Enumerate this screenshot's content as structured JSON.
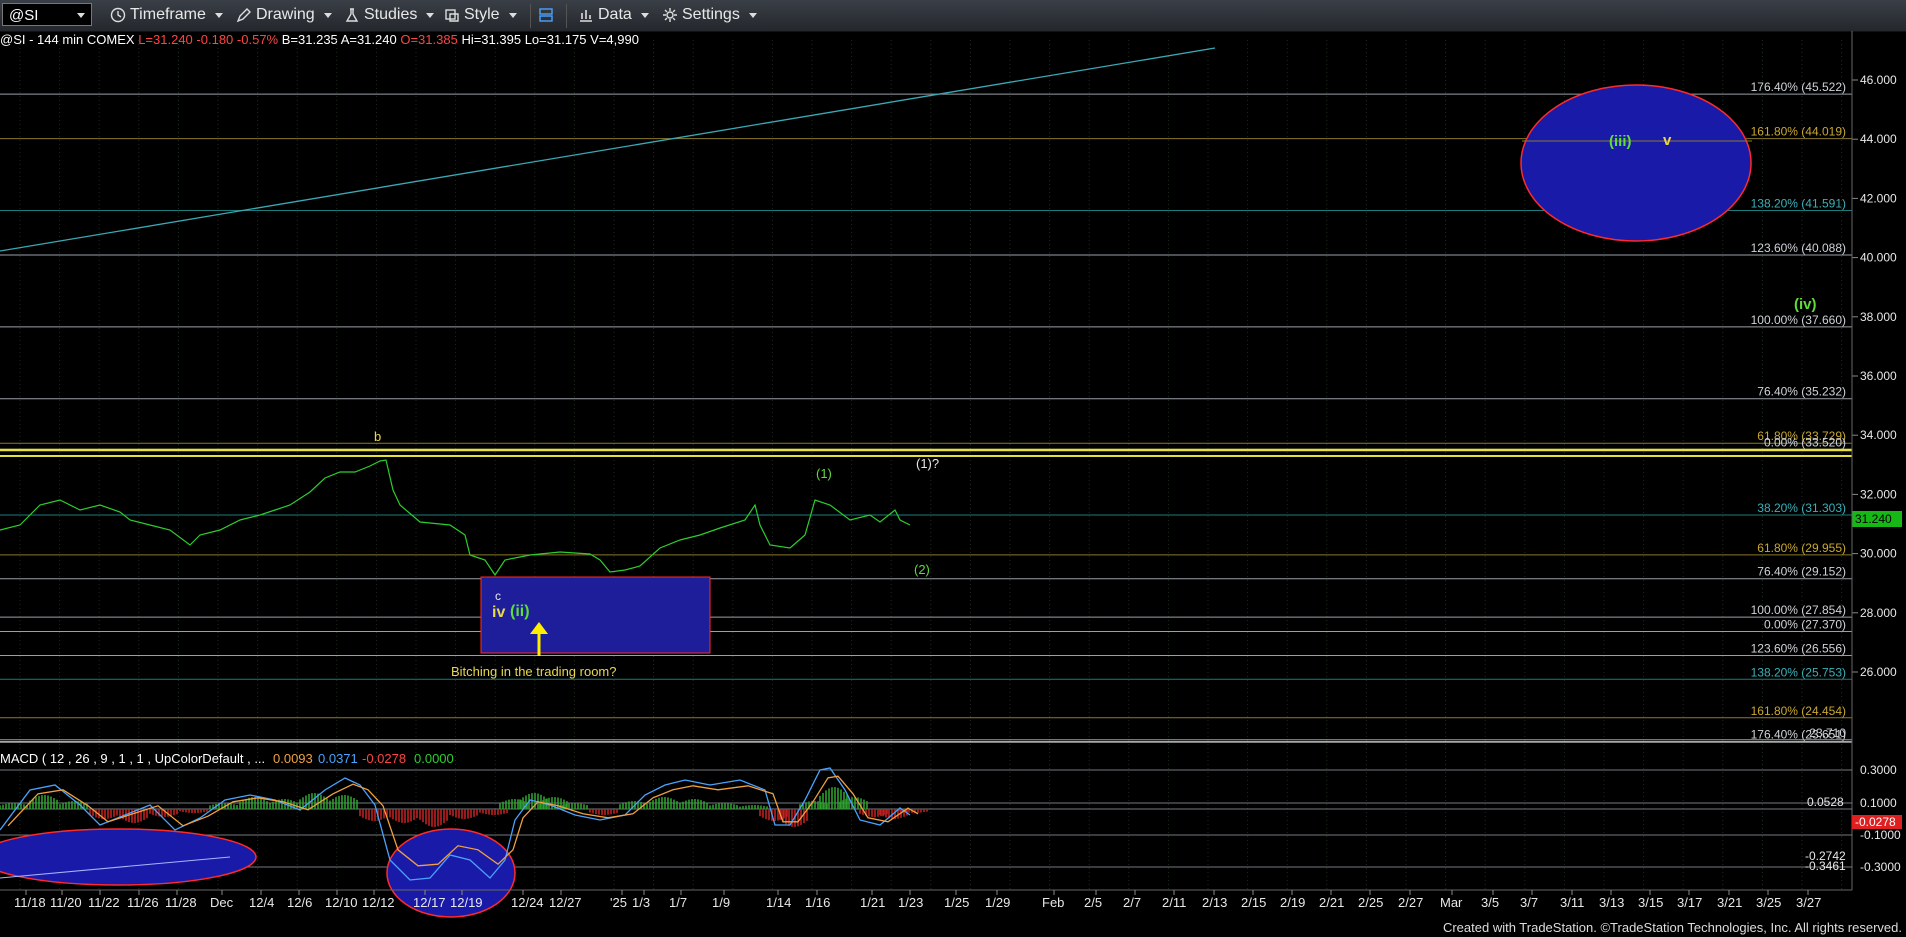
{
  "toolbar": {
    "symbol": "@SI",
    "timeframe": "Timeframe",
    "drawing": "Drawing",
    "studies": "Studies",
    "style": "Style",
    "data": "Data",
    "settings": "Settings"
  },
  "quote": {
    "title": "@SI - 144 min",
    "exchange": "COMEX",
    "last": "L=31.240",
    "change": "-0.180",
    "pct": "-0.57%",
    "bid": "B=31.235",
    "ask": "A=31.240",
    "open": "O=31.385",
    "high": "Hi=31.395",
    "low": "Lo=31.175",
    "volume": "V=4,990"
  },
  "price_axis": [
    "46.000",
    "44.000",
    "42.000",
    "40.000",
    "38.000",
    "36.000",
    "34.000",
    "32.000",
    "30.000",
    "28.000",
    "26.000"
  ],
  "last_price_tag": "31.240",
  "fib_levels": [
    {
      "label": "176.40% (45.522)",
      "price": 45.522,
      "color": "#9aa0a8"
    },
    {
      "label": "161.80% (44.019)",
      "price": 44.019,
      "color": "#8a7a2a"
    },
    {
      "label": "138.20% (41.591)",
      "price": 41.591,
      "color": "#1c7c7c"
    },
    {
      "label": "123.60% (40.088)",
      "price": 40.088,
      "color": "#9aa0a8"
    },
    {
      "label": "100.00% (37.660)",
      "price": 37.66,
      "color": "#9aa0a8"
    },
    {
      "label": "76.40% (35.232)",
      "price": 35.232,
      "color": "#9aa0a8"
    },
    {
      "label": "61.80% (33.729)",
      "price": 33.729,
      "color": "#8a7a2a"
    },
    {
      "label": "0.00% (33.520)",
      "price": 33.52,
      "color": "#9aa0a8"
    },
    {
      "label": "38.20% (31.303)",
      "price": 31.303,
      "color": "#1c7c7c"
    },
    {
      "label": "61.80% (29.955)",
      "price": 29.955,
      "color": "#8a7a2a"
    },
    {
      "label": "76.40% (29.152)",
      "price": 29.152,
      "color": "#9aa0a8"
    },
    {
      "label": "100.00% (27.854)",
      "price": 27.854,
      "color": "#9aa0a8"
    },
    {
      "label": "0.00% (27.370)",
      "price": 27.37,
      "color": "#9aa0a8"
    },
    {
      "label": "123.60% (26.556)",
      "price": 26.556,
      "color": "#9aa0a8"
    },
    {
      "label": "138.20% (25.753)",
      "price": 25.753,
      "color": "#1c7c7c"
    },
    {
      "label": "161.80% (24.454)",
      "price": 24.454,
      "color": "#8a7a2a"
    },
    {
      "label": "176.40% (23.651)",
      "price": 23.651,
      "color": "#9aa0a8"
    },
    {
      "label": "23.710",
      "price": 23.71,
      "color": "#9aa0a8"
    }
  ],
  "annotations": {
    "b": "b",
    "c": "c",
    "iv": "iv",
    "ii": "(ii)",
    "one": "(1)",
    "one_q": "(1)?",
    "two": "(2)",
    "iii": "(iii)",
    "v": "v",
    "iv_green": "(iv)",
    "comment": "Bitching in the trading room?"
  },
  "macd": {
    "legend": "MACD ( 12 , 26 , 9 , 1 , 1 , UpColorDefault , ...",
    "v1": "0.0093",
    "v2": "0.0371",
    "v3": "-0.0278",
    "v4": "0.0000",
    "axis": [
      "0.3000",
      "0.1000",
      "-0.1000",
      "-0.3000"
    ],
    "tag_a": "0.0528",
    "tag_b": "-0.0278",
    "tag_c": "-0.2742",
    "tag_d": "-0.3461"
  },
  "date_labels": [
    "11/18",
    "11/20",
    "11/22",
    "11/26",
    "11/28",
    "Dec",
    "12/4",
    "12/6",
    "12/10",
    "12/12",
    "12/17",
    "12/19",
    "12/24",
    "12/27",
    "'25",
    "1/3",
    "1/7",
    "1/9",
    "1/14",
    "1/16",
    "1/21",
    "1/23",
    "1/25",
    "1/29",
    "Feb",
    "2/5",
    "2/7",
    "2/11",
    "2/13",
    "2/15",
    "2/19",
    "2/21",
    "2/25",
    "2/27",
    "Mar",
    "3/5",
    "3/7",
    "3/11",
    "3/13",
    "3/15",
    "3/17",
    "3/21",
    "3/25",
    "3/27"
  ],
  "footer": "Created with TradeStation. ©TradeStation Technologies, Inc. All rights reserved.",
  "colors": {
    "price": "#2ecc2e",
    "fib_gray": "#9aa0a8",
    "fib_gold": "#8a7a2a",
    "fib_teal": "#1c7c7c",
    "box": "#1e1e9a",
    "ellipse_stroke": "#ff2a2a",
    "annot_yellow": "#e8d84a",
    "annot_green": "#5fdc3a"
  }
}
